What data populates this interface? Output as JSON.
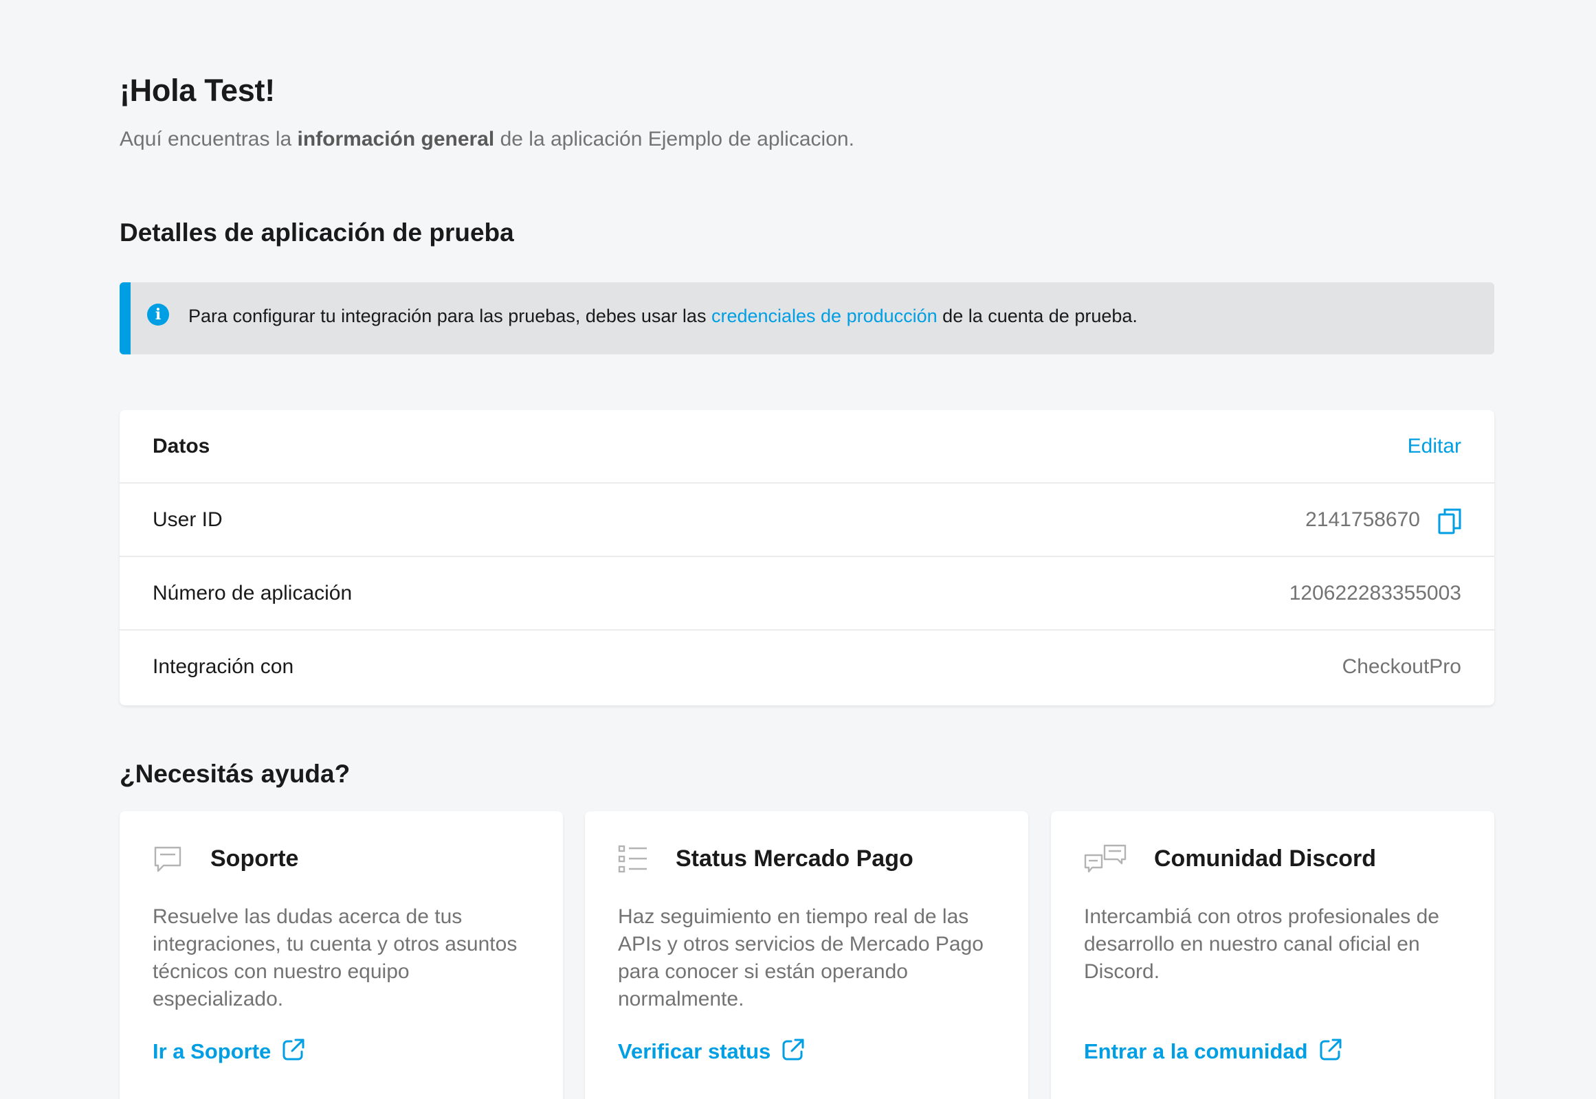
{
  "header": {
    "greeting": "¡Hola Test!",
    "subtitle_prefix": "Aquí encuentras la ",
    "subtitle_bold": "información general",
    "subtitle_suffix": " de la aplicación Ejemplo de aplicacion."
  },
  "details": {
    "title": "Detalles de aplicación de prueba",
    "info_banner": {
      "icon": "info-icon",
      "text_prefix": "Para configurar tu integración para las pruebas, debes usar las ",
      "link_text": "credenciales de producción",
      "text_suffix": " de la cuenta de prueba."
    },
    "data_card": {
      "title": "Datos",
      "edit_label": "Editar",
      "rows": [
        {
          "label": "User ID",
          "value": "2141758670",
          "copy_icon": "copy-icon"
        },
        {
          "label": "Número de aplicación",
          "value": "120622283355003"
        },
        {
          "label": "Integración con",
          "value": "CheckoutPro"
        }
      ]
    }
  },
  "help": {
    "title": "¿Necesitás ayuda?",
    "cards": [
      {
        "icon": "chat-bubble-icon",
        "title": "Soporte",
        "description": "Resuelve las dudas acerca de tus integraciones, tu cuenta y otros asuntos técnicos con nuestro equipo especializado.",
        "link": "Ir a Soporte"
      },
      {
        "icon": "list-icon",
        "title": "Status Mercado Pago",
        "description": "Haz seguimiento en tiempo real de las APIs y otros servicios de Mercado Pago para conocer si están operando normalmente.",
        "link": "Verificar status"
      },
      {
        "icon": "community-chat-icon",
        "title": "Comunidad Discord",
        "description": "Intercambiá con otros profesionales de desarrollo en nuestro canal oficial en Discord.",
        "link": "Entrar a la comunidad"
      }
    ],
    "link_icon": "external-link-icon"
  },
  "colors": {
    "accent": "#009ee3",
    "background": "#f5f6f8",
    "banner_bg": "#e2e3e5",
    "muted_text": "#737373"
  }
}
